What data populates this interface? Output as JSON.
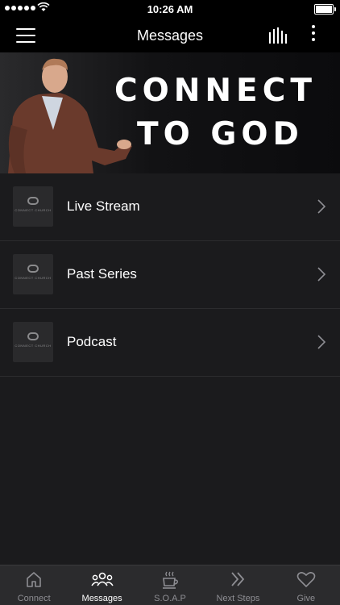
{
  "status_bar": {
    "time": "10:26 AM"
  },
  "nav": {
    "title": "Messages"
  },
  "hero": {
    "line1": "CONNECT",
    "line2": "TO GOD"
  },
  "list": {
    "thumb_text": "CONNECT CHURCH",
    "items": [
      {
        "label": "Live Stream"
      },
      {
        "label": "Past Series"
      },
      {
        "label": "Podcast"
      }
    ]
  },
  "tabs": [
    {
      "label": "Connect",
      "icon": "home-icon",
      "active": false
    },
    {
      "label": "Messages",
      "icon": "people-icon",
      "active": true
    },
    {
      "label": "S.O.A.P",
      "icon": "coffee-cup-icon",
      "active": false
    },
    {
      "label": "Next Steps",
      "icon": "double-chevron-right-icon",
      "active": false
    },
    {
      "label": "Give",
      "icon": "heart-icon",
      "active": false
    }
  ],
  "colors": {
    "background": "#1b1b1d",
    "bar": "#000000",
    "tab_bar": "#2b2b2d",
    "inactive": "#8e8e93"
  }
}
